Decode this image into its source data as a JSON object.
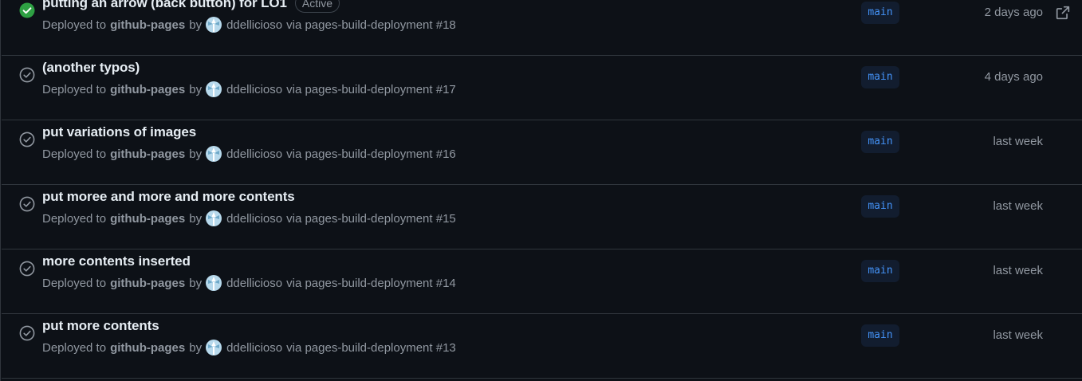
{
  "colors": {
    "background": "#0d1117",
    "border": "#30363d",
    "success": "#2ea043",
    "muted": "#9198a1",
    "branch_text": "#4493f8",
    "branch_bg": "#121d2f"
  },
  "deployments": [
    {
      "title": "putting an arrow (back button) for LO1",
      "badge": "Active",
      "status_icon": "check-circle-fill-icon",
      "deployed_to": "Deployed to",
      "environment": "github-pages",
      "by": "by",
      "user": "ddellicioso",
      "via": "via pages-build-deployment #18",
      "branch": "main",
      "time": "2 days ago",
      "external_icon": "link-external-icon"
    },
    {
      "title": "(another typos)",
      "badge": "",
      "status_icon": "check-circle-icon",
      "deployed_to": "Deployed to",
      "environment": "github-pages",
      "by": "by",
      "user": "ddellicioso",
      "via": "via pages-build-deployment #17",
      "branch": "main",
      "time": "4 days ago"
    },
    {
      "title": "put variations of images",
      "badge": "",
      "status_icon": "check-circle-icon",
      "deployed_to": "Deployed to",
      "environment": "github-pages",
      "by": "by",
      "user": "ddellicioso",
      "via": "via pages-build-deployment #16",
      "branch": "main",
      "time": "last week"
    },
    {
      "title": "put moree and more and more contents",
      "badge": "",
      "status_icon": "check-circle-icon",
      "deployed_to": "Deployed to",
      "environment": "github-pages",
      "by": "by",
      "user": "ddellicioso",
      "via": "via pages-build-deployment #15",
      "branch": "main",
      "time": "last week"
    },
    {
      "title": "more contents inserted",
      "badge": "",
      "status_icon": "check-circle-icon",
      "deployed_to": "Deployed to",
      "environment": "github-pages",
      "by": "by",
      "user": "ddellicioso",
      "via": "via pages-build-deployment #14",
      "branch": "main",
      "time": "last week"
    },
    {
      "title": "put more contents",
      "badge": "",
      "status_icon": "check-circle-icon",
      "deployed_to": "Deployed to",
      "environment": "github-pages",
      "by": "by",
      "user": "ddellicioso",
      "via": "via pages-build-deployment #13",
      "branch": "main",
      "time": "last week"
    }
  ]
}
